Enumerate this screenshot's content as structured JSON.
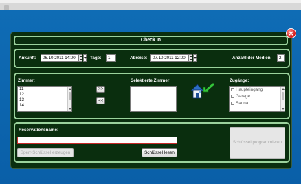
{
  "dialog": {
    "title": "Check In",
    "close_label": "×"
  },
  "booking": {
    "arrival_label": "Ankunft:",
    "arrival_value": "06.10.2011 14:00",
    "days_label": "Tage:",
    "days_value": "1",
    "departure_label": "Abreise:",
    "departure_value": "07.10.2011 12:00",
    "media_count_label": "Anzahl der Medien",
    "media_count_value": "2"
  },
  "rooms": {
    "rooms_label": "Zimmer:",
    "room_items": [
      "11",
      "12",
      "13",
      "14"
    ],
    "add_button": ">>",
    "remove_button": "<<",
    "selected_label": "Selektierte Zimmer:",
    "access_label": "Zugänge:",
    "access_items": [
      "Haupteingang",
      "Garage",
      "Sauna"
    ],
    "icon": "house-key-arrow-icon"
  },
  "reservation": {
    "name_label": "Reservationsname:",
    "name_value": "",
    "spare_key_button": "Sperr-Schlüssel erzeugen",
    "read_key_button": "Schlüssel lesen",
    "program_key_button": "Schlüssel programmieren"
  },
  "colors": {
    "background": "#0a5fa8",
    "panel": "#0a2e0e",
    "panel_border": "#9bd29c",
    "close": "#d11a1a"
  }
}
